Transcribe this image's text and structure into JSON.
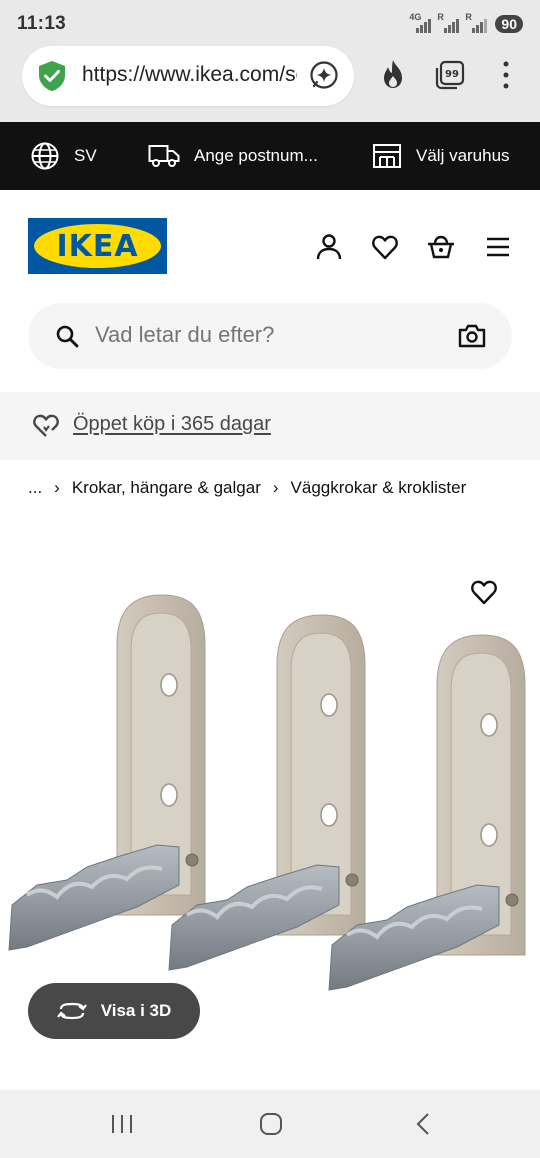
{
  "status_bar": {
    "time": "11:13",
    "network_label": "4G",
    "sim1_label": "R",
    "sim2_label": "R",
    "battery": "90"
  },
  "browser": {
    "url": "https://www.ikea.com/se/sv/",
    "tab_count": "99",
    "icons": [
      "shield-check-icon",
      "sparkle-icon",
      "flame-icon",
      "tabs-icon",
      "more-vertical-icon"
    ]
  },
  "top_bar": {
    "language": "SV",
    "postal_code": "Ange postnum...",
    "store": "Välj varuhus"
  },
  "header": {
    "logo_text": "IKEA"
  },
  "search": {
    "placeholder": "Vad letar du efter?"
  },
  "promo": {
    "text": "Öppet köp i 365 dagar"
  },
  "breadcrumb": {
    "ellipsis": "...",
    "items": [
      "Krokar, hängare & galgar",
      "Väggkrokar & kroklister"
    ]
  },
  "product": {
    "view_3d_label": "Visa i 3D"
  },
  "colors": {
    "ikea_blue": "#0058a3",
    "ikea_yellow": "#ffdb00",
    "hook_beige": "#c9bfb2",
    "hook_metal": "#9aa1a8"
  }
}
